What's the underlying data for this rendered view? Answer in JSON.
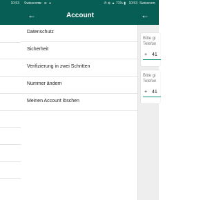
{
  "left": {
    "status_time": "10:53"
  },
  "middle": {
    "status": {
      "carrier": "Swisscom",
      "sim_icons": "≋ ≋ ♦",
      "sys_icons": "✆ ⊛ ▲ 71% ▮",
      "time": "10:53"
    },
    "appbar": {
      "back": "←",
      "title": "Account"
    },
    "menu": [
      {
        "label": "Datenschutz"
      },
      {
        "label": "Sicherheit"
      },
      {
        "label": "Verifizierung in zwei Schritten"
      },
      {
        "label": "Nummer ändern"
      },
      {
        "label": "Meinen Account löschen"
      }
    ]
  },
  "right": {
    "status_carrier": "Swisscom",
    "appbar": {
      "back": "←"
    },
    "cards": [
      {
        "line1": "Bitte gi",
        "line2": "Telefon",
        "plus": "+",
        "code": "41"
      },
      {
        "line1": "Bitte gi",
        "line2": "Telefon",
        "plus": "+",
        "code": "41"
      }
    ]
  },
  "colors": {
    "appbar": "#075e54",
    "accent": "#0a8f7e"
  }
}
